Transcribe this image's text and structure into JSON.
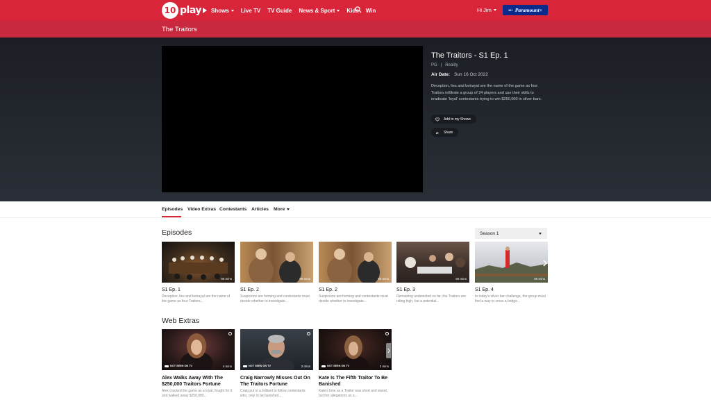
{
  "nav": {
    "logo_mark": "10",
    "logo_text": "play",
    "links": [
      {
        "label": "Shows",
        "dropdown": true
      },
      {
        "label": "Live TV",
        "dropdown": false
      },
      {
        "label": "TV Guide",
        "dropdown": false
      },
      {
        "label": "News & Sport",
        "dropdown": true
      },
      {
        "label": "Kids",
        "dropdown": false
      },
      {
        "label": "Win",
        "dropdown": false
      }
    ],
    "user_greeting": "Hi Jim",
    "paramount_tag": "10+",
    "paramount_label": "Paramount+"
  },
  "show": {
    "title": "The Traitors"
  },
  "episode": {
    "title": "The Traitors - S1 Ep. 1",
    "rating": "PG",
    "separator": "|",
    "genre": "Reality",
    "air_date_label": "Air Date:",
    "air_date": "Sun 16 Oct 2022",
    "description": "Deception, lies and betrayal are the name of the game as four Traitors infiltrate a group of 24 players and use their skills to eradicate 'loyal' contestants trying to win $250,000 in silver bars.",
    "add_label": "Add to my Shows",
    "share_label": "Share"
  },
  "tabs": [
    {
      "label": "Episodes",
      "active": true
    },
    {
      "label": "Video Extras",
      "active": false
    },
    {
      "label": "Contestants",
      "active": false
    },
    {
      "label": "Articles",
      "active": false
    },
    {
      "label": "More",
      "active": false
    }
  ],
  "episodes_section": {
    "title": "Episodes",
    "season_selected": "Season 1",
    "items": [
      {
        "title": "S1 Ep. 1",
        "duration": "90 mins",
        "desc": "Deception, lies and betrayal are the name of the game as four Traitors..."
      },
      {
        "title": "S1 Ep. 2",
        "duration": "90 mins",
        "desc": "Suspicions are forming and contestants must decide whether to investigate..."
      },
      {
        "title": "S1 Ep. 2",
        "duration": "90 mins",
        "desc": "Suspicions are forming and contestants must decide whether to investigate..."
      },
      {
        "title": "S1 Ep. 3",
        "duration": "90 mins",
        "desc": "Remaining undetected so far, the Traitors are riding high, but a potential..."
      },
      {
        "title": "S1 Ep. 4",
        "duration": "90 mins",
        "desc": "In today's silver bar challenge, the group must find a way to cross a bridge..."
      }
    ]
  },
  "web_extras": {
    "title": "Web Extras",
    "badge": "NOT SEEN ON TV",
    "items": [
      {
        "title": "Alex Walks Away With The $250,000 Traitors Fortune",
        "duration": "4 mins",
        "desc": "Alex cracked the game as a loyal, fought for it and walked away $250,000..."
      },
      {
        "title": "Craig Narrowly Misses Out On The Traitors Fortune",
        "duration": "2 mins",
        "desc": "Craig put in a brilliant to follow contestants who, only to be banished..."
      },
      {
        "title": "Kate Is The Fifth Traitor To Be Banished",
        "duration": "2 mins",
        "desc": "Kate's time as a Traitor was short and sweet, but her allegations as a..."
      }
    ]
  },
  "colors": {
    "brand_red": "#d9253a",
    "title_bar": "#c8293f",
    "paramount_blue": "#0b2a8a"
  }
}
